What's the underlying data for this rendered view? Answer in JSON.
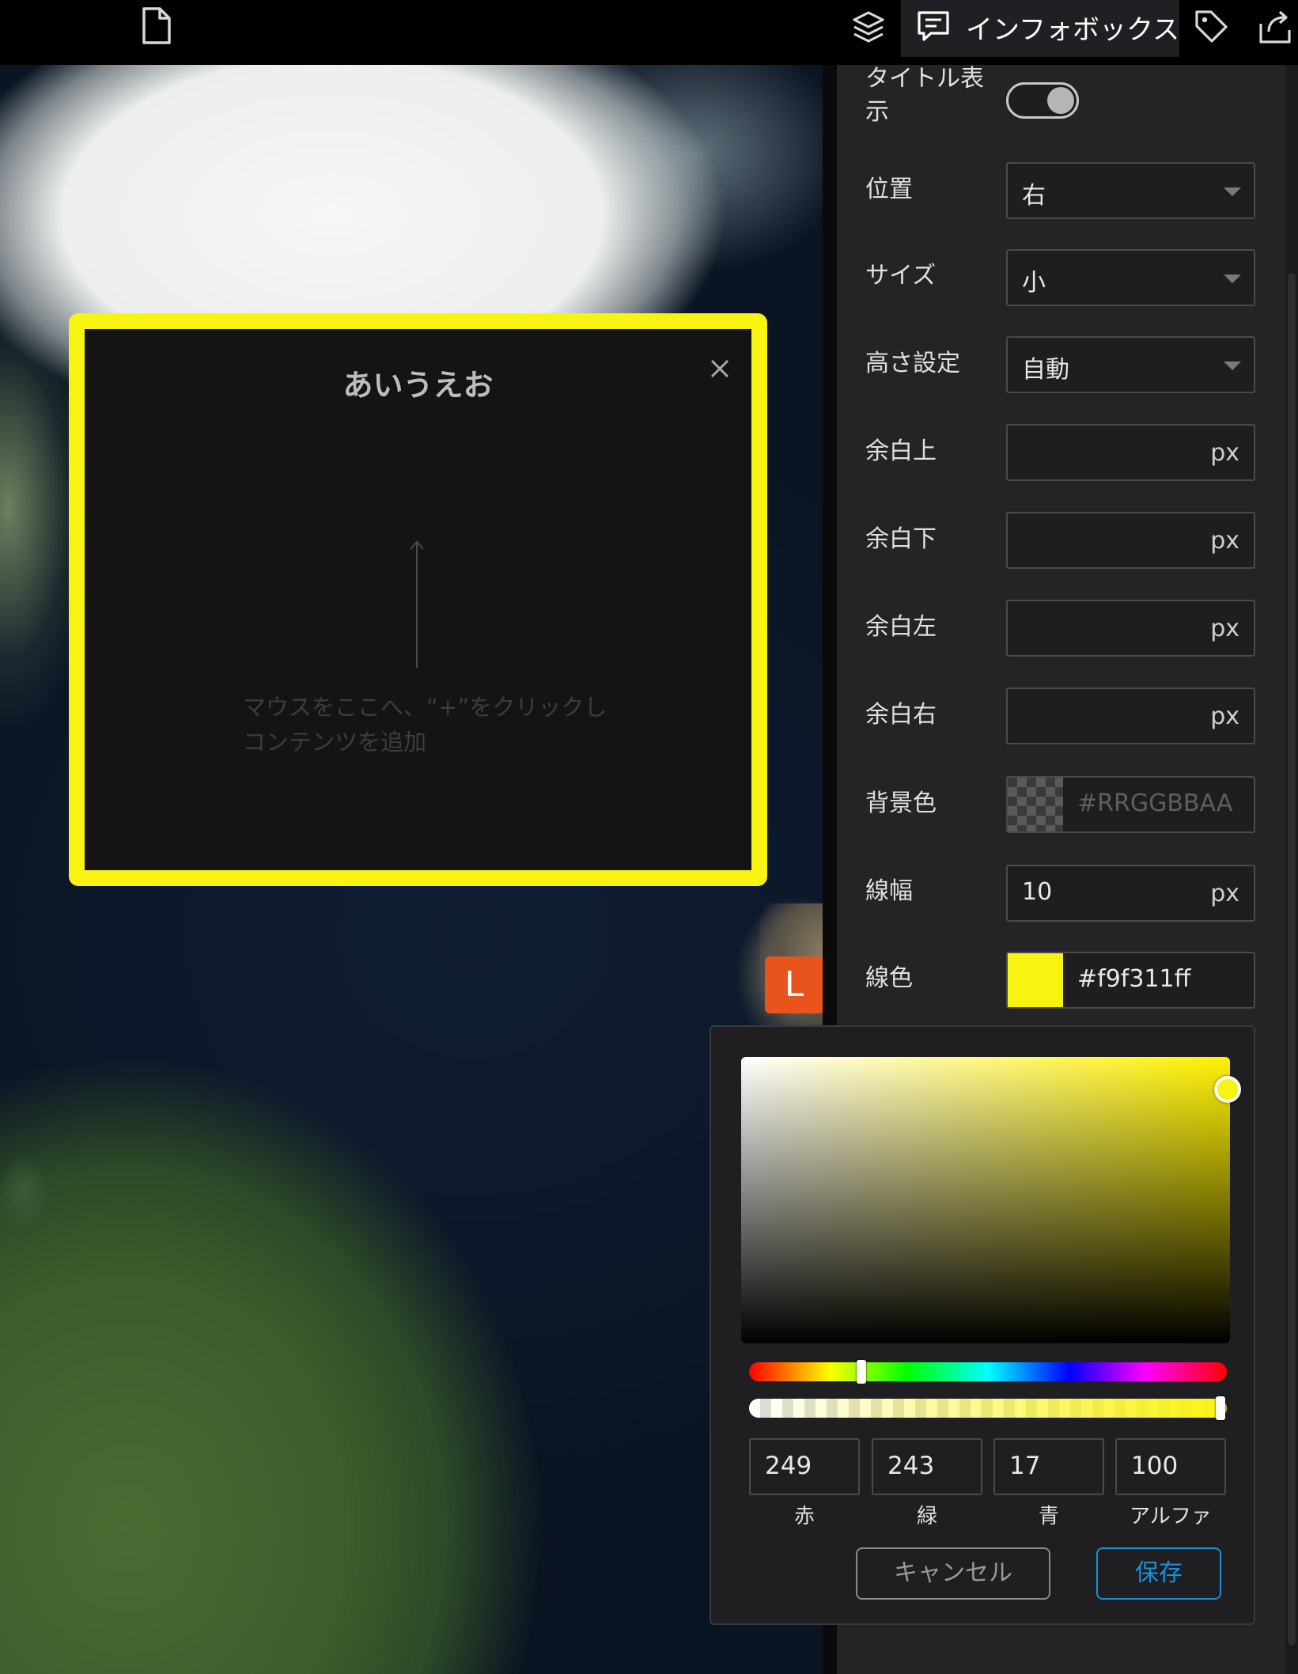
{
  "topbar": {
    "active_tab_label": "インフォボックス",
    "icons": [
      "file-icon",
      "layers-icon",
      "chat-icon",
      "tag-icon",
      "export-icon"
    ]
  },
  "infobox": {
    "title": "あいうえお",
    "hint_line1": "マウスをここへ、“+”をクリックし",
    "hint_line2": "コンテンツを追加",
    "border_color": "#f9f311"
  },
  "marker": {
    "label": "L",
    "color": "#e9531c"
  },
  "panel": {
    "title_display": {
      "label_line1": "タイトル表",
      "label_line2": "示",
      "enabled": true
    },
    "position": {
      "label": "位置",
      "value": "右"
    },
    "size": {
      "label": "サイズ",
      "value": "小"
    },
    "height": {
      "label": "高さ設定",
      "value": "自動"
    },
    "margin_top": {
      "label": "余白上",
      "value": "",
      "unit": "px"
    },
    "margin_bottom": {
      "label": "余白下",
      "value": "",
      "unit": "px"
    },
    "margin_left": {
      "label": "余白左",
      "value": "",
      "unit": "px"
    },
    "margin_right": {
      "label": "余白右",
      "value": "",
      "unit": "px"
    },
    "background_color": {
      "label": "背景色",
      "placeholder": "#RRGGBBAA"
    },
    "border_width": {
      "label": "線幅",
      "value": "10",
      "unit": "px"
    },
    "border_color": {
      "label": "線色",
      "value": "#f9f311ff",
      "swatch": "#f9f311"
    }
  },
  "color_picker": {
    "hue_color": "#fff200",
    "red": {
      "value": "249",
      "label": "赤"
    },
    "green": {
      "value": "243",
      "label": "緑"
    },
    "blue": {
      "value": "17",
      "label": "青"
    },
    "alpha": {
      "value": "100",
      "label": "アルファ"
    },
    "cancel_label": "キャンセル",
    "save_label": "保存"
  }
}
